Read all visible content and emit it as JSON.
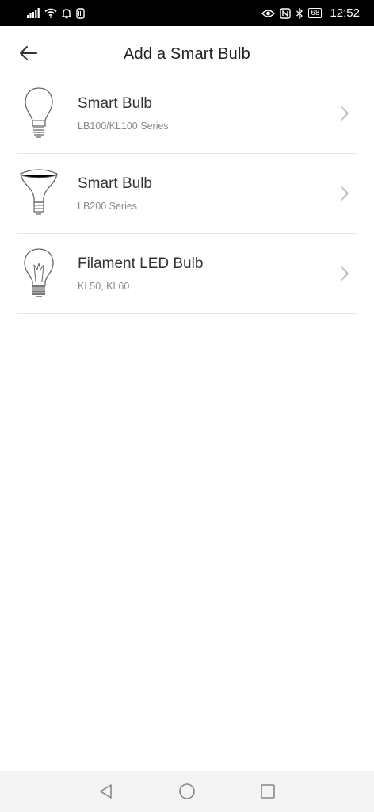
{
  "status_bar": {
    "time": "12:52",
    "battery": "68",
    "icons": [
      "signal-icon",
      "wifi-icon",
      "bell-icon",
      "sim-icon",
      "eye-icon",
      "nfc-icon",
      "bluetooth-icon"
    ]
  },
  "header": {
    "title": "Add a Smart Bulb",
    "back_icon": "arrow-left-icon"
  },
  "items": [
    {
      "title": "Smart Bulb",
      "subtitle": "LB100/KL100 Series",
      "icon": "a19-bulb-icon"
    },
    {
      "title": "Smart Bulb",
      "subtitle": "LB200 Series",
      "icon": "br30-bulb-icon"
    },
    {
      "title": "Filament LED Bulb",
      "subtitle": "KL50, KL60",
      "icon": "filament-bulb-icon"
    }
  ],
  "nav_bar": {
    "icons": [
      "back-triangle-icon",
      "home-circle-icon",
      "recents-square-icon"
    ]
  },
  "colors": {
    "status_bar_bg": "#000000",
    "divider": "#e6e6e6",
    "title_text": "#222222",
    "subtitle_text": "#8a8a8a",
    "nav_bg": "#f4f4f4"
  }
}
